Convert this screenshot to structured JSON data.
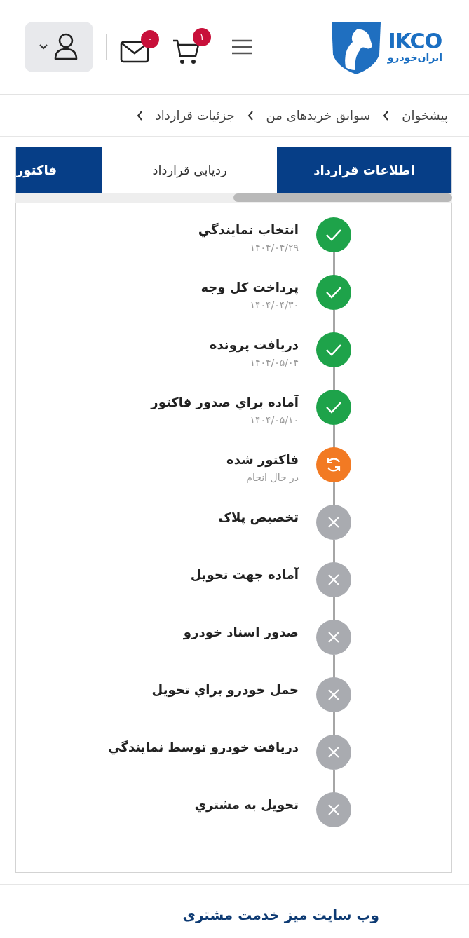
{
  "header": {
    "logo": {
      "latin": "IKCO",
      "persian": "ایران‌خودرو"
    },
    "cart_badge": "۱",
    "mail_badge": "۰"
  },
  "breadcrumb": [
    "پیشخوان",
    "سوابق خریدهای من",
    "جزئیات قرارداد"
  ],
  "tabs": [
    {
      "label": "اطلاعات قرارداد",
      "selected": false
    },
    {
      "label": "ردیابی قرارداد",
      "selected": true
    },
    {
      "label": "فاکتور",
      "selected": false
    }
  ],
  "steps": [
    {
      "title": "انتخاب نمايندگي",
      "subtitle": "۱۴۰۴/۰۴/۲۹",
      "kind": "done"
    },
    {
      "title": "پرداخت کل وجه",
      "subtitle": "۱۴۰۴/۰۴/۳۰",
      "kind": "done"
    },
    {
      "title": "دریافت پرونده",
      "subtitle": "۱۴۰۴/۰۵/۰۴",
      "kind": "done"
    },
    {
      "title": "آماده براي صدور فاکتور",
      "subtitle": "۱۴۰۴/۰۵/۱۰",
      "kind": "done"
    },
    {
      "title": "فاکتور شده",
      "subtitle": "در حال انجام",
      "kind": "progress"
    },
    {
      "title": "تخصیص پلاک",
      "kind": "pending"
    },
    {
      "title": "آماده جهت تحویل",
      "kind": "pending"
    },
    {
      "title": "صدور اسناد خودرو",
      "kind": "pending"
    },
    {
      "title": "حمل خودرو براي تحویل",
      "kind": "pending"
    },
    {
      "title": "دریافت خودرو توسط نمایندگي",
      "kind": "pending"
    },
    {
      "title": "تحویل به مشتري",
      "kind": "pending"
    }
  ],
  "footer": {
    "link": "وب سایت میز خدمت مشتری"
  }
}
